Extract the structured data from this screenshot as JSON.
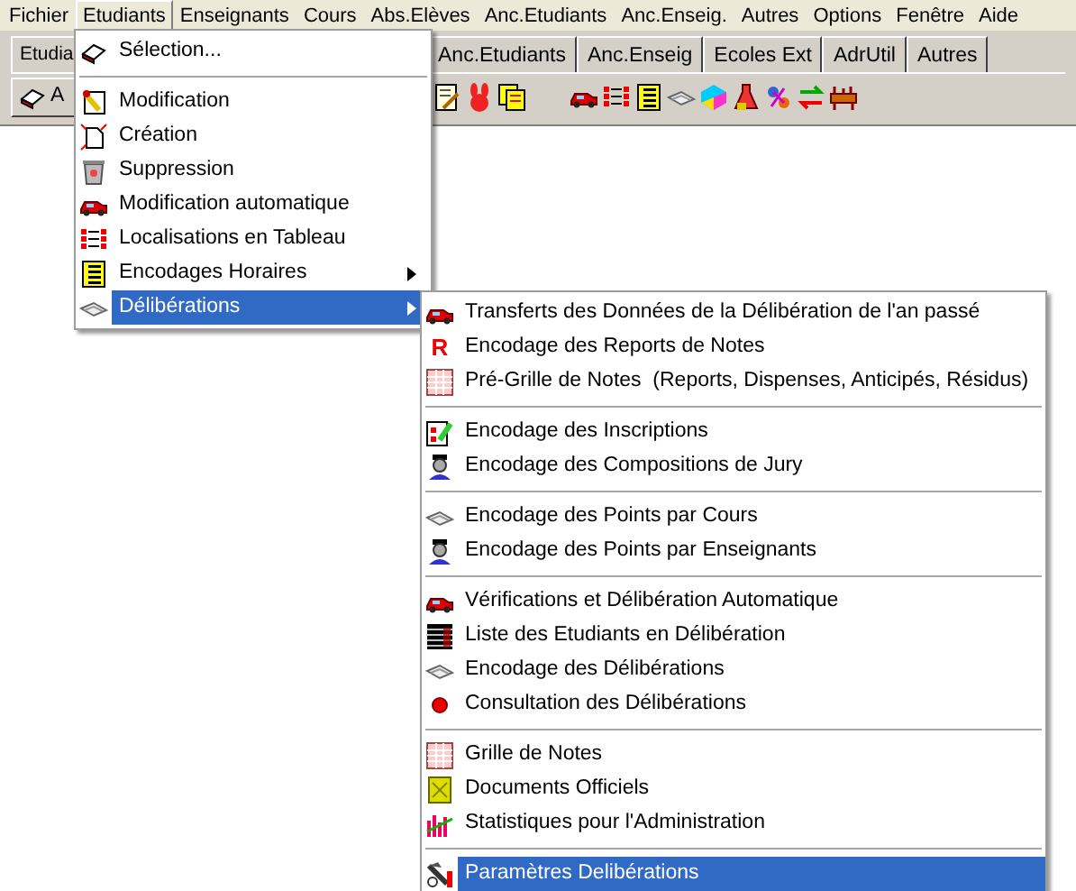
{
  "menubar": [
    {
      "label": "Fichier",
      "selected": false
    },
    {
      "label": "Etudiants",
      "selected": true
    },
    {
      "label": "Enseignants",
      "selected": false
    },
    {
      "label": "Cours",
      "selected": false
    },
    {
      "label": "Abs.Elèves",
      "selected": false
    },
    {
      "label": "Anc.Etudiants",
      "selected": false
    },
    {
      "label": "Anc.Enseig.",
      "selected": false
    },
    {
      "label": "Autres",
      "selected": false
    },
    {
      "label": "Options",
      "selected": false
    },
    {
      "label": "Fenêtre",
      "selected": false
    },
    {
      "label": "Aide",
      "selected": false
    }
  ],
  "tabs_left": [
    {
      "label": "Etudia"
    }
  ],
  "tabs_right": [
    {
      "label": "Anc.Etudiants"
    },
    {
      "label": "Anc.Enseig"
    },
    {
      "label": "Ecoles Ext"
    },
    {
      "label": "AdrUtil"
    },
    {
      "label": "Autres"
    }
  ],
  "toolbar_button": {
    "label": "A"
  },
  "menu": {
    "groups": [
      [
        {
          "label": "Sélection...",
          "has_submenu": false,
          "selected": false
        }
      ],
      [
        {
          "label": "Modification",
          "has_submenu": false,
          "selected": false
        },
        {
          "label": "Création",
          "has_submenu": false,
          "selected": false
        },
        {
          "label": "Suppression",
          "has_submenu": false,
          "selected": false
        },
        {
          "label": "Modification automatique",
          "has_submenu": false,
          "selected": false
        },
        {
          "label": "Localisations en Tableau",
          "has_submenu": false,
          "selected": false
        },
        {
          "label": "Encodages Horaires",
          "has_submenu": true,
          "selected": false
        },
        {
          "label": "Délibérations",
          "has_submenu": true,
          "selected": true
        }
      ]
    ]
  },
  "submenu": {
    "groups": [
      [
        {
          "label": "Transferts des Données de la Délibération de l'an passé",
          "selected": false
        },
        {
          "label": "Encodage des Reports de Notes",
          "icon_text": "R",
          "selected": false
        },
        {
          "label": "Pré-Grille de Notes  (Reports, Dispenses, Anticipés, Résidus)",
          "selected": false
        }
      ],
      [
        {
          "label": "Encodage des Inscriptions",
          "selected": false
        },
        {
          "label": "Encodage des Compositions de Jury",
          "selected": false
        }
      ],
      [
        {
          "label": "Encodage des Points par Cours",
          "selected": false
        },
        {
          "label": "Encodage des Points par Enseignants",
          "selected": false
        }
      ],
      [
        {
          "label": "Vérifications et Délibération Automatique",
          "selected": false
        },
        {
          "label": "Liste des Etudiants en Délibération",
          "selected": false
        },
        {
          "label": "Encodage des Délibérations",
          "selected": false
        },
        {
          "label": "Consultation des Délibérations",
          "selected": false
        }
      ],
      [
        {
          "label": "Grille de Notes",
          "selected": false
        },
        {
          "label": "Documents Officiels",
          "selected": false
        },
        {
          "label": "Statistiques pour l'Administration",
          "selected": false
        }
      ],
      [
        {
          "label": "Paramètres Delibérations",
          "selected": true
        }
      ]
    ]
  }
}
